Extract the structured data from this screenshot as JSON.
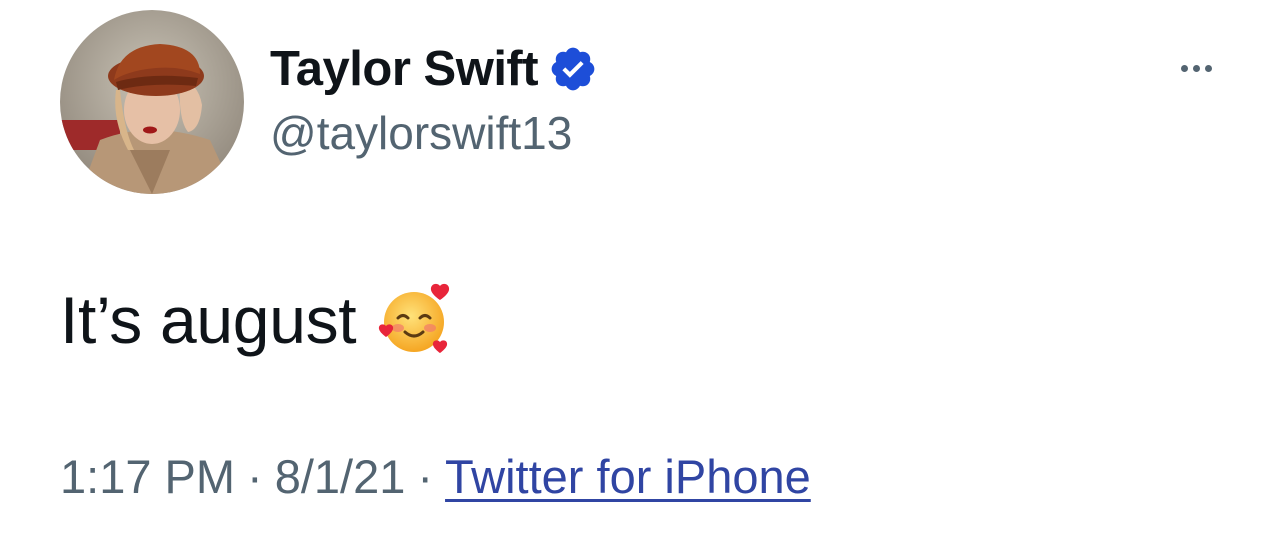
{
  "author": {
    "display_name": "Taylor Swift",
    "handle": "@taylorswift13",
    "verified": true,
    "avatar_icon": "profile-photo-red-hat"
  },
  "tweet": {
    "text": "It’s august",
    "emoji_icon": "smiling-face-with-hearts-emoji"
  },
  "meta": {
    "time": "1:17 PM",
    "separator": "·",
    "date": "8/1/21",
    "source": "Twitter for iPhone"
  },
  "menu": {
    "icon": "more-options-icon"
  },
  "colors": {
    "text_primary": "#0f1419",
    "text_secondary": "#536471",
    "verified_badge": "#1d4ed8",
    "link": "#3045a3"
  }
}
